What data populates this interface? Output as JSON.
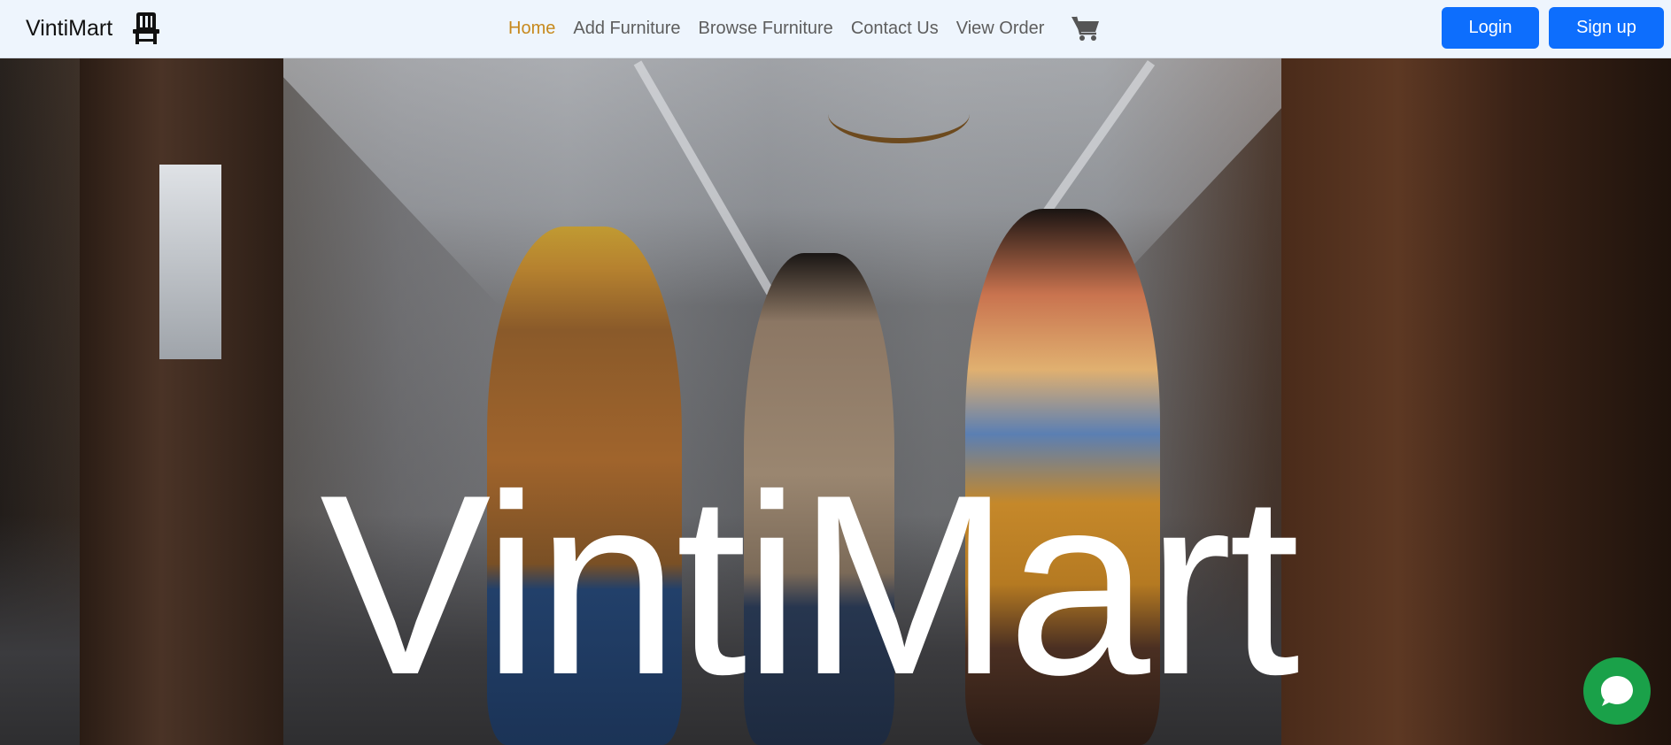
{
  "navbar": {
    "brand": "VintiMart",
    "brand_icon": "chair-icon",
    "links": [
      {
        "label": "Home",
        "active": true
      },
      {
        "label": "Add Furniture",
        "active": false
      },
      {
        "label": "Browse Furniture",
        "active": false
      },
      {
        "label": "Contact Us",
        "active": false
      },
      {
        "label": "View Order",
        "active": false
      }
    ],
    "cart_icon": "cart-icon",
    "login_label": "Login",
    "signup_label": "Sign up"
  },
  "hero": {
    "title": "VintiMart",
    "background": "photo of people walking through a vintage furniture store"
  },
  "chat": {
    "icon": "chat-icon"
  },
  "colors": {
    "navbar_bg": "#eef5fd",
    "active_link": "#c7891d",
    "link": "#5d5d5d",
    "button_primary": "#0d6efd",
    "chat_button": "#1aa149",
    "hero_text": "#ffffff"
  }
}
